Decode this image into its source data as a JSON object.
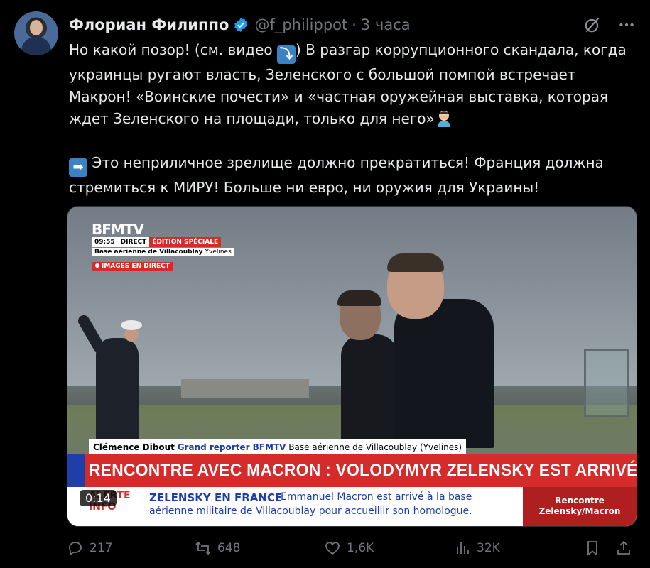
{
  "author": {
    "name": "Флориан Филиппо",
    "handle": "@f_philippot",
    "separator": "·",
    "time": "3 часа"
  },
  "tweet": {
    "p1_a": "Но какой позор! (см. видео ",
    "p1_emoji": "⤵",
    "p1_b": ") В разгар коррупционного скандала, когда украинцы ругают власть, Зеленского с большой помпой встречает Макрон! «Воинские почести» и «частная оружейная выставка, которая ждет Зеленского на площади, только для него»",
    "p2_emoji": "➡",
    "p2": " Это неприличное зрелище должно прекратиться! Франция должна стремиться к МИРУ! Больше ни евро, ни оружия для Украины!"
  },
  "video": {
    "logo": "BFMTV",
    "live_time": "09:55",
    "live_tag": "DIRECT",
    "edition": "ÉDITION SPÉCIALE",
    "location": "Base aérienne de Villacoublay",
    "location_sub": "Yvelines",
    "images_direct": "IMAGES EN DIRECT",
    "reporter_name": "Clémence Dibout",
    "reporter_role": "Grand reporter BFMTV",
    "reporter_place": "Base aérienne de Villacoublay (Yvelines)",
    "headline": "RENCONTRE AVEC MACRON : VOLODYMYR ZELENSKY EST ARRIVÉ",
    "alert_line1": "ALERTE",
    "alert_line2": "INFO",
    "ticker_title": "ZELENSKY EN FRANCE",
    "ticker_body": "Emmanuel Macron est arrivé à la base",
    "ticker_body2": "aérienne militaire de Villacoublay pour accueillir son homologue.",
    "ticker_right1": "Rencontre",
    "ticker_right2": "Zelensky/Macron",
    "duration": "0:14"
  },
  "actions": {
    "replies": "217",
    "reposts": "648",
    "likes": "1,6K",
    "views": "32K"
  },
  "colors": {
    "background": "#000000",
    "text": "#e7e9ea",
    "muted": "#71767b",
    "verified": "#1d9bf0",
    "bfm_red": "#d52b2b",
    "bfm_blue": "#1e3ea8"
  }
}
